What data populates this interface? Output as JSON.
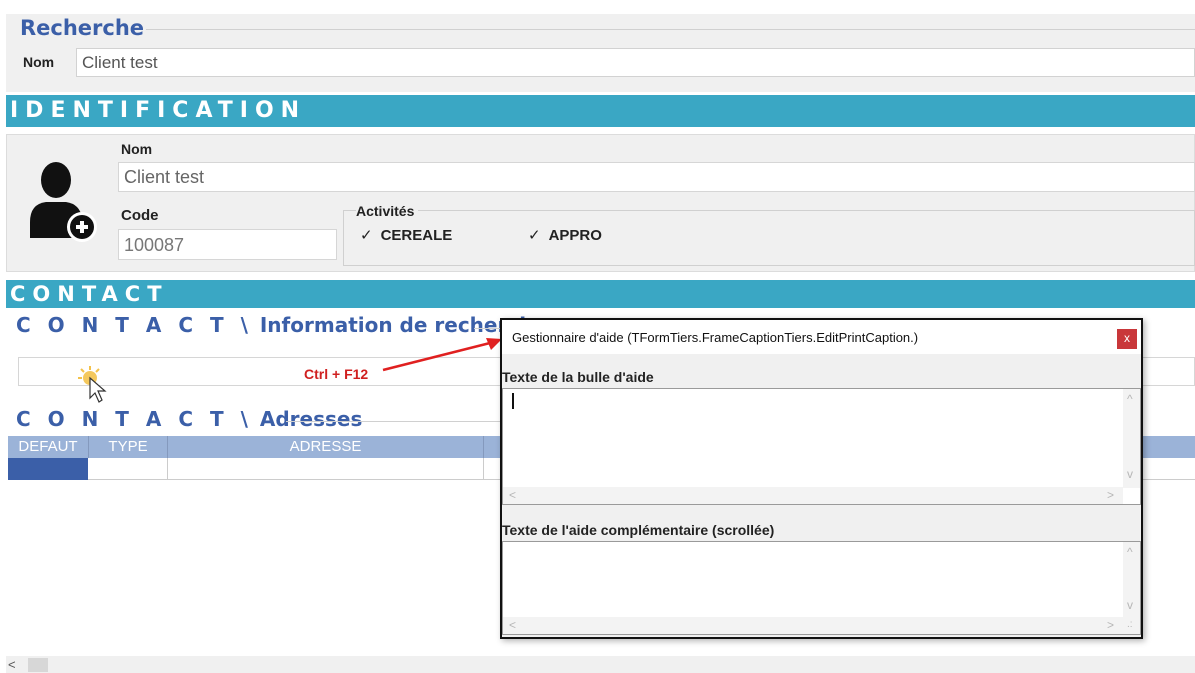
{
  "recherche": {
    "title": "Recherche",
    "nom_label": "Nom",
    "nom_value": "Client test"
  },
  "identification": {
    "band_title": "IDENTIFICATION",
    "avatar_icon": "add-user-icon",
    "nom_label": "Nom",
    "nom_value": "Client test",
    "code_label": "Code",
    "code_value": "100087",
    "activites_label": "Activités",
    "activites": [
      {
        "label": "CEREALE",
        "checked": true
      },
      {
        "label": "APPRO",
        "checked": true
      }
    ]
  },
  "contact": {
    "band_title": "CONTACT",
    "info_title_prefix": "C O N T A C T \\",
    "info_title_rest": " Information de recherche",
    "adr_title_prefix": "C O N T A C T \\",
    "adr_title_rest": " Adresses",
    "columns": [
      "DEFAUT",
      "TYPE",
      "ADRESSE"
    ]
  },
  "annotation": {
    "shortcut": "Ctrl + F12",
    "arrow_color": "#e02020"
  },
  "help_dialog": {
    "title": "Gestionnaire d'aide (TFormTiers.FrameCaptionTiers.EditPrintCaption.)",
    "close_label": "x",
    "tooltip_label": "Texte de la bulle d'aide",
    "extra_label": "Texte de l'aide complémentaire (scrollée)"
  },
  "colors": {
    "band": "#3aa7c4",
    "section_title": "#3b5fa8",
    "grid_header": "#9bb3d8",
    "close_button": "#c9373a"
  }
}
